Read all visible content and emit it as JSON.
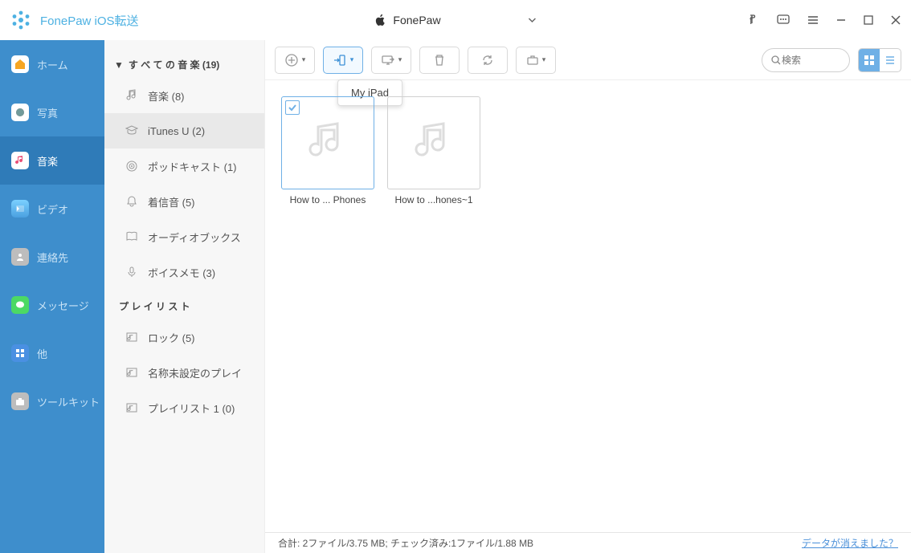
{
  "app_title": "FonePaw iOS転送",
  "device": {
    "name": "FonePaw"
  },
  "leftnav": [
    {
      "label": "ホーム",
      "icon_color": "#f6a623"
    },
    {
      "label": "写真",
      "icon_color": "#e94e77"
    },
    {
      "label": "音楽",
      "icon_color": "#e94e77",
      "active": true
    },
    {
      "label": "ビデオ",
      "icon_color": "#ffffff"
    },
    {
      "label": "連絡先",
      "icon_color": "#bdbdbd"
    },
    {
      "label": "メッセージ",
      "icon_color": "#4cd964"
    },
    {
      "label": "他",
      "icon_color": "#4a90e2"
    },
    {
      "label": "ツールキット",
      "icon_color": "#bdbdbd"
    }
  ],
  "category_header": "す べ て の 音 楽  (19)",
  "categories": [
    {
      "label": "音楽 (8)"
    },
    {
      "label": "iTunes U (2)",
      "selected": true
    },
    {
      "label": "ポッドキャスト (1)"
    },
    {
      "label": "着信音 (5)"
    },
    {
      "label": "オーディオブックス"
    },
    {
      "label": "ボイスメモ (3)"
    }
  ],
  "playlist_header": "プ レ イ リ ス ト",
  "playlists": [
    {
      "label": "ロック (5)"
    },
    {
      "label": "名称未設定のプレイ"
    },
    {
      "label": "プレイリスト 1 (0)"
    }
  ],
  "dropdown_item": "My iPad",
  "files": [
    {
      "name": "How to ... Phones",
      "selected": true
    },
    {
      "name": "How to ...hones~1"
    }
  ],
  "search_placeholder": "検索",
  "status_left": "合計: 2ファイル/3.75 MB; チェック済み:1ファイル/1.88 MB",
  "status_link": "データが消えました？"
}
